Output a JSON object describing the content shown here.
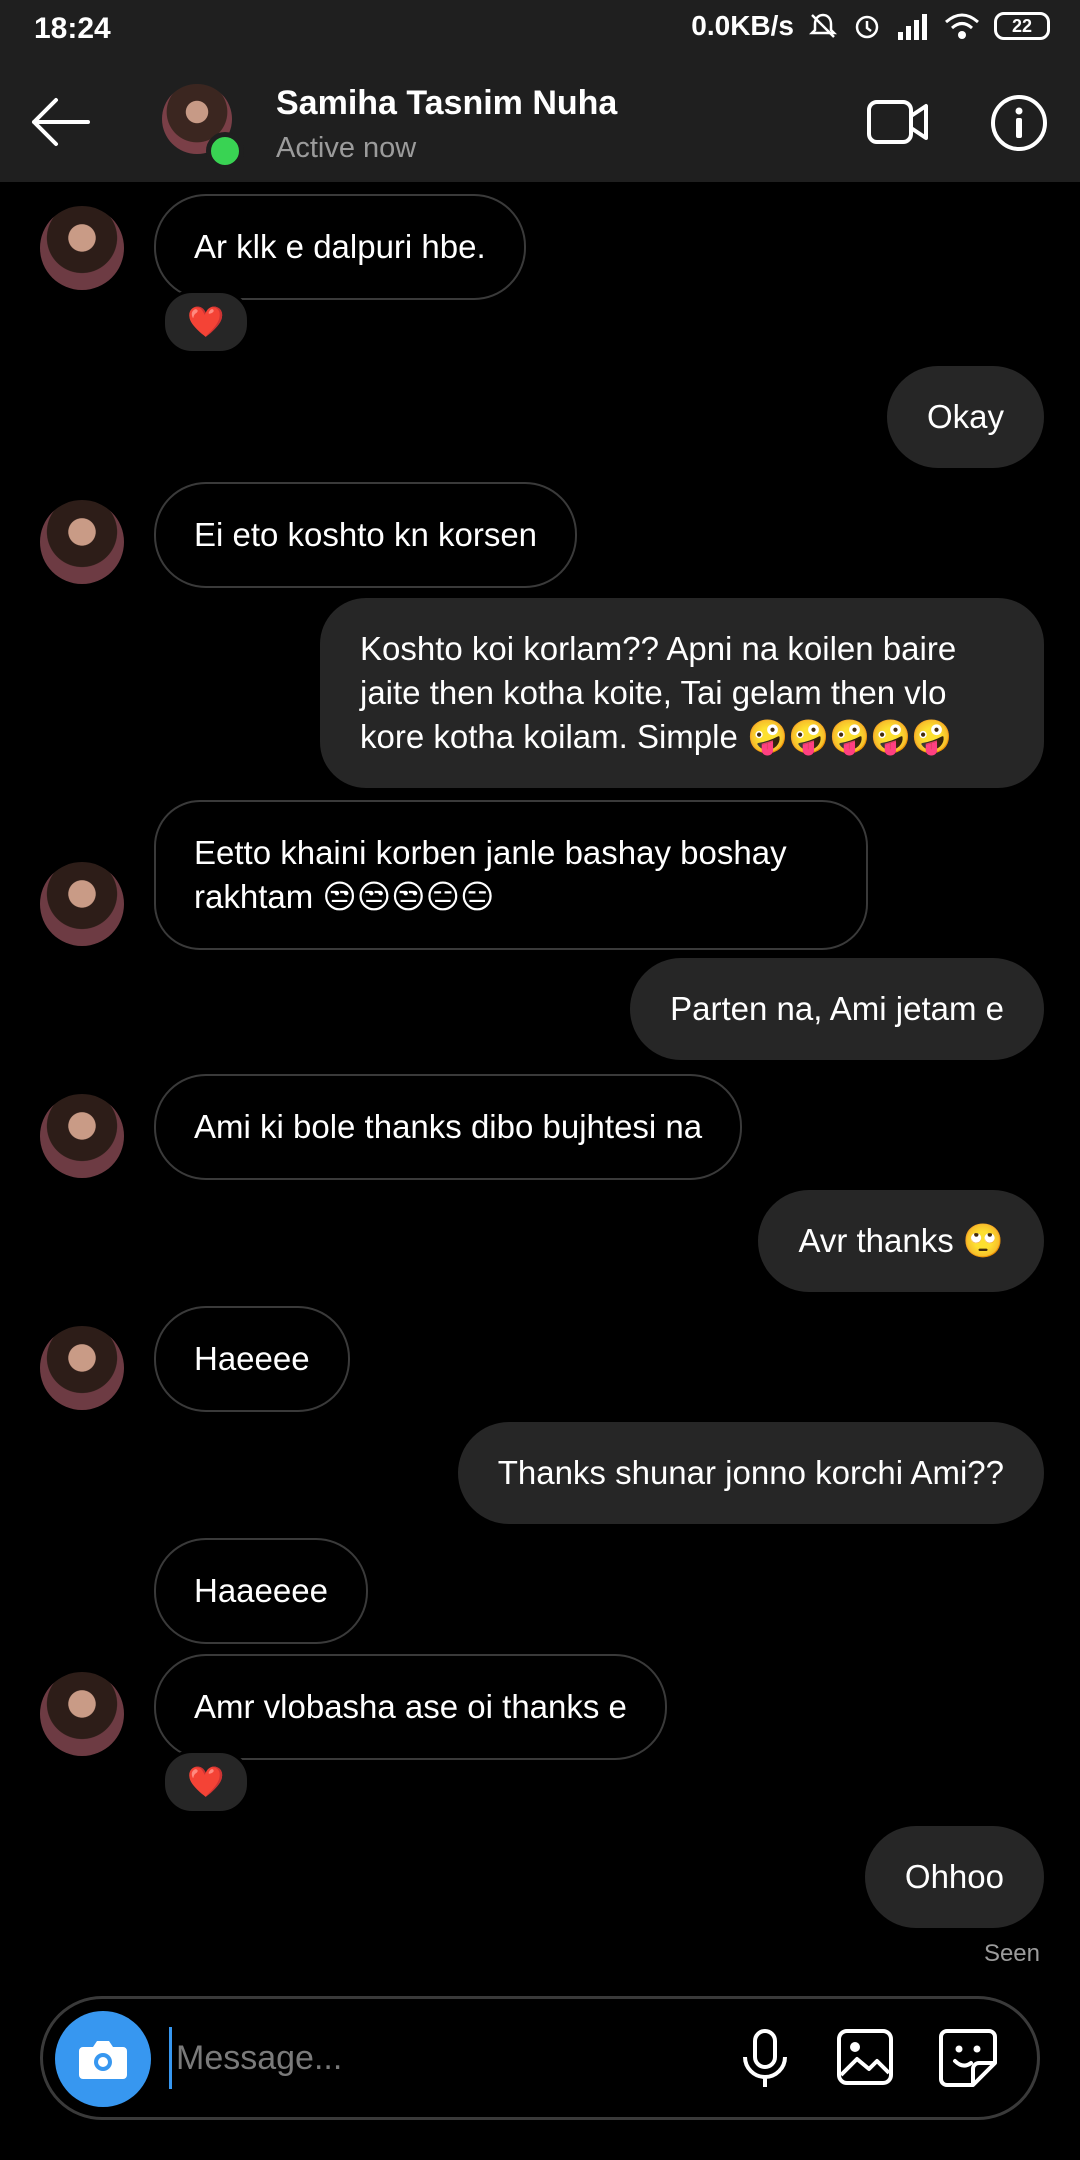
{
  "status_bar": {
    "time": "18:24",
    "network_speed": "0.0KB/s",
    "battery": "22"
  },
  "header": {
    "contact_name": "Samiha Tasnim Nuha",
    "status": "Active now"
  },
  "messages": [
    {
      "side": "in",
      "text": "Ar klk e dalpuri hbe."
    },
    {
      "side": "in",
      "reaction": "❤️"
    },
    {
      "side": "out",
      "text": "Okay"
    },
    {
      "side": "in",
      "text": "Ei eto koshto kn korsen"
    },
    {
      "side": "out",
      "text": "Koshto koi korlam?? Apni na koilen baire jaite then kotha koite, Tai gelam then vlo kore kotha koilam. Simple 🤪🤪🤪🤪🤪"
    },
    {
      "side": "in",
      "text": "Eetto khaini korben janle bashay boshay rakhtam 😒😒😒😑😑"
    },
    {
      "side": "out",
      "text": "Parten na, Ami jetam e"
    },
    {
      "side": "in",
      "text": "Ami ki bole thanks dibo bujhtesi na"
    },
    {
      "side": "out",
      "text": "Avr thanks 🙄"
    },
    {
      "side": "in",
      "text": "Haeeee"
    },
    {
      "side": "out",
      "text": "Thanks shunar jonno korchi Ami??"
    },
    {
      "side": "in",
      "text": "Haaeeee"
    },
    {
      "side": "in",
      "text": "Amr vlobasha ase oi thanks e"
    },
    {
      "side": "in",
      "reaction": "❤️"
    },
    {
      "side": "out",
      "text": "Ohhoo"
    }
  ],
  "seen_label": "Seen",
  "composer": {
    "placeholder": "Message..."
  },
  "colors": {
    "accent": "#3797f0",
    "online": "#39d353",
    "outgoing_bubble": "#262626",
    "incoming_border": "#3a3a3a"
  },
  "icons": [
    "back-arrow-icon",
    "video-call-icon",
    "info-icon",
    "camera-icon",
    "microphone-icon",
    "gallery-icon",
    "sticker-icon"
  ]
}
